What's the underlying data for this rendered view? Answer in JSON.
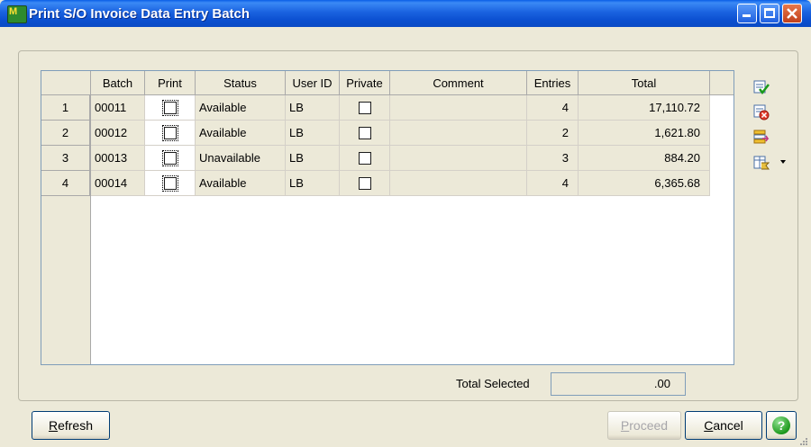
{
  "window": {
    "title": "Print S/O Invoice Data Entry Batch",
    "app_icon_text": "M"
  },
  "grid": {
    "columns": [
      "Batch",
      "Print",
      "Status",
      "User ID",
      "Private",
      "Comment",
      "Entries",
      "Total"
    ],
    "rows": [
      {
        "num": "1",
        "batch": "00011",
        "print": false,
        "status": "Available",
        "user_id": "LB",
        "private": false,
        "comment": "",
        "entries": "4",
        "total": "17,110.72"
      },
      {
        "num": "2",
        "batch": "00012",
        "print": false,
        "status": "Available",
        "user_id": "LB",
        "private": false,
        "comment": "",
        "entries": "2",
        "total": "1,621.80"
      },
      {
        "num": "3",
        "batch": "00013",
        "print": false,
        "status": "Unavailable",
        "user_id": "LB",
        "private": false,
        "comment": "",
        "entries": "3",
        "total": "884.20"
      },
      {
        "num": "4",
        "batch": "00014",
        "print": false,
        "status": "Available",
        "user_id": "LB",
        "private": false,
        "comment": "",
        "entries": "4",
        "total": "6,365.68"
      }
    ]
  },
  "side_icons": [
    "select-all-icon",
    "clear-all-icon",
    "toggle-selection-icon",
    "filter-icon"
  ],
  "totals": {
    "label": "Total Selected",
    "value": ".00"
  },
  "buttons": {
    "refresh_prefix": "R",
    "refresh_rest": "efresh",
    "proceed_prefix": "P",
    "proceed_rest": "roceed",
    "cancel_prefix": "C",
    "cancel_rest": "ancel",
    "help": "?"
  },
  "colors": {
    "titlebar": "#0a4ac4",
    "face": "#ece9d8",
    "help_green": "#1e9a1e"
  }
}
